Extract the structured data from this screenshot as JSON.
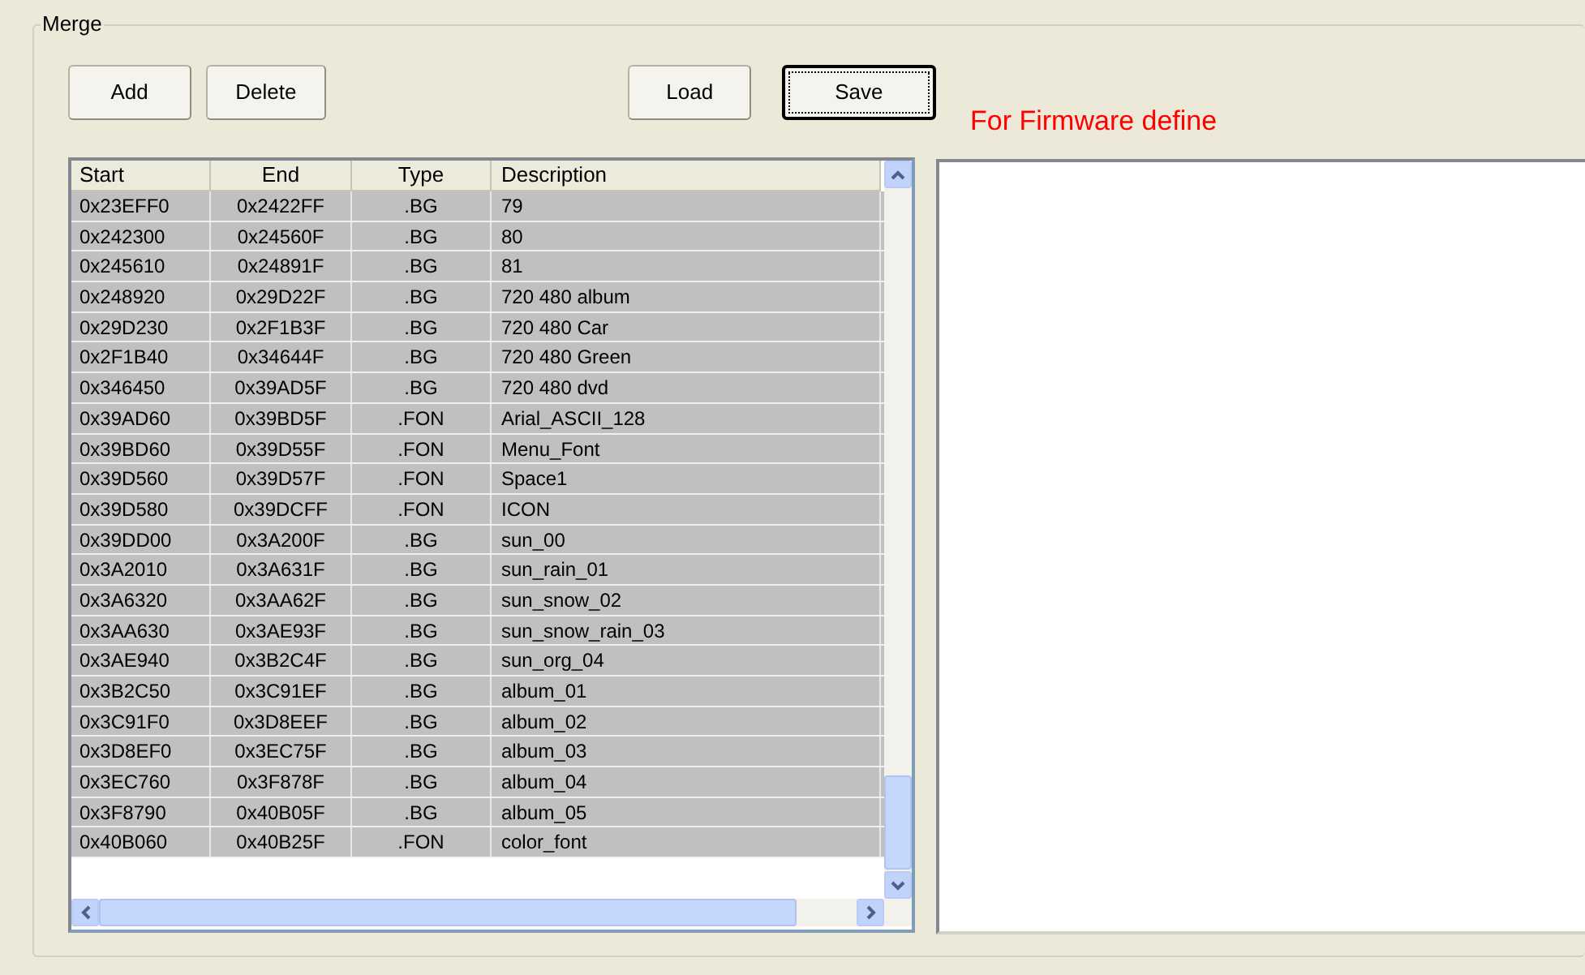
{
  "group": {
    "title": "Merge"
  },
  "buttons": [
    {
      "label": "Add",
      "focused": false
    },
    {
      "label": "Delete",
      "focused": false
    },
    {
      "label": "Load",
      "focused": false
    },
    {
      "label": "Save",
      "focused": true
    }
  ],
  "note": "For Firmware define",
  "table": {
    "columns": [
      "Start",
      "End",
      "Type",
      "Description"
    ],
    "rows": [
      {
        "cells": [
          "0x23EFF0",
          "0x2422FF",
          ".BG",
          "79"
        ],
        "selected": true
      },
      {
        "cells": [
          "0x242300",
          "0x24560F",
          ".BG",
          "80"
        ],
        "selected": true
      },
      {
        "cells": [
          "0x245610",
          "0x24891F",
          ".BG",
          "81"
        ],
        "selected": true
      },
      {
        "cells": [
          "0x248920",
          "0x29D22F",
          ".BG",
          "720 480 album"
        ],
        "selected": true
      },
      {
        "cells": [
          "0x29D230",
          "0x2F1B3F",
          ".BG",
          "720 480 Car"
        ],
        "selected": true
      },
      {
        "cells": [
          "0x2F1B40",
          "0x34644F",
          ".BG",
          "720 480 Green"
        ],
        "selected": true
      },
      {
        "cells": [
          "0x346450",
          "0x39AD5F",
          ".BG",
          "720 480 dvd"
        ],
        "selected": true
      },
      {
        "cells": [
          "0x39AD60",
          "0x39BD5F",
          ".FON",
          "Arial_ASCII_128"
        ],
        "selected": true
      },
      {
        "cells": [
          "0x39BD60",
          "0x39D55F",
          ".FON",
          "Menu_Font"
        ],
        "selected": true
      },
      {
        "cells": [
          "0x39D560",
          "0x39D57F",
          ".FON",
          "Space1"
        ],
        "selected": true
      },
      {
        "cells": [
          "0x39D580",
          "0x39DCFF",
          ".FON",
          "ICON"
        ],
        "selected": true
      },
      {
        "cells": [
          "0x39DD00",
          "0x3A200F",
          ".BG",
          "sun_00"
        ],
        "selected": true
      },
      {
        "cells": [
          "0x3A2010",
          "0x3A631F",
          ".BG",
          "sun_rain_01"
        ],
        "selected": true
      },
      {
        "cells": [
          "0x3A6320",
          "0x3AA62F",
          ".BG",
          "sun_snow_02"
        ],
        "selected": true
      },
      {
        "cells": [
          "0x3AA630",
          "0x3AE93F",
          ".BG",
          "sun_snow_rain_03"
        ],
        "selected": true
      },
      {
        "cells": [
          "0x3AE940",
          "0x3B2C4F",
          ".BG",
          "sun_org_04"
        ],
        "selected": true
      },
      {
        "cells": [
          "0x3B2C50",
          "0x3C91EF",
          ".BG",
          "album_01"
        ],
        "selected": true
      },
      {
        "cells": [
          "0x3C91F0",
          "0x3D8EEF",
          ".BG",
          "album_02"
        ],
        "selected": true
      },
      {
        "cells": [
          "0x3D8EF0",
          "0x3EC75F",
          ".BG",
          "album_03"
        ],
        "selected": true
      },
      {
        "cells": [
          "0x3EC760",
          "0x3F878F",
          ".BG",
          "album_04"
        ],
        "selected": true
      },
      {
        "cells": [
          "0x3F8790",
          "0x40B05F",
          ".BG",
          "album_05"
        ],
        "selected": true
      },
      {
        "cells": [
          "0x40B060",
          "0x40B25F",
          ".FON",
          "color_font"
        ],
        "selected": true
      }
    ]
  }
}
